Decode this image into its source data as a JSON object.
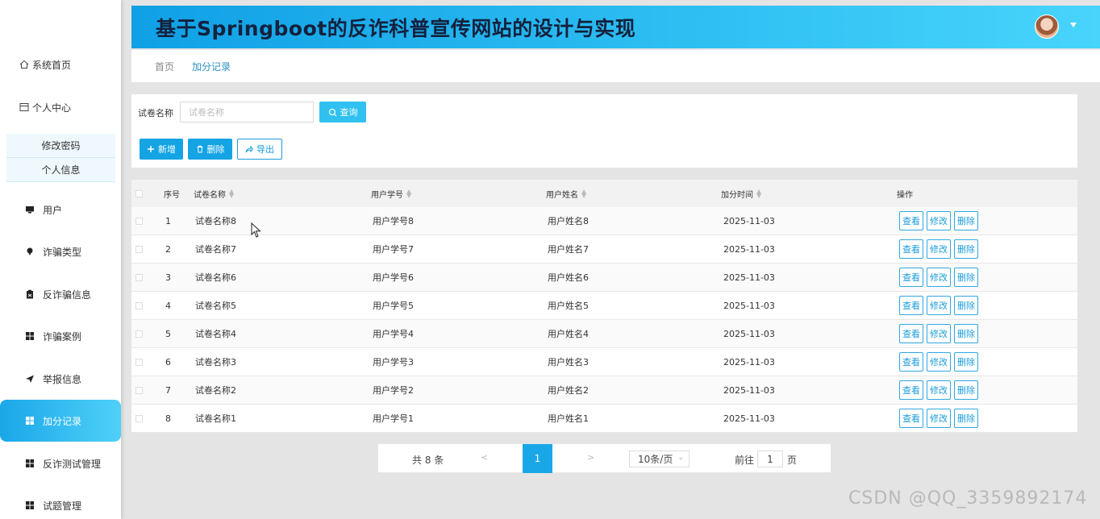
{
  "app": {
    "title": "基于Springboot的反诈科普宣传网站的设计与实现"
  },
  "sidebar": {
    "items": [
      {
        "label": "系统首页",
        "icon": "home-icon"
      },
      {
        "label": "个人中心",
        "icon": "user-card-icon"
      },
      {
        "label": "用户",
        "icon": "monitor-icon"
      },
      {
        "label": "诈骗类型",
        "icon": "pin-icon"
      },
      {
        "label": "反诈骗信息",
        "icon": "clipboard-icon"
      },
      {
        "label": "诈骗案例",
        "icon": "grid-icon"
      },
      {
        "label": "举报信息",
        "icon": "send-icon"
      },
      {
        "label": "加分记录",
        "icon": "grid-icon"
      },
      {
        "label": "反诈测试管理",
        "icon": "grid-icon"
      },
      {
        "label": "试题管理",
        "icon": "grid-icon"
      }
    ],
    "subitems": [
      {
        "label": "修改密码"
      },
      {
        "label": "个人信息"
      }
    ],
    "active": "加分记录"
  },
  "breadcrumb": {
    "home": "首页",
    "current": "加分记录"
  },
  "search": {
    "label": "试卷名称",
    "placeholder": "试卷名称",
    "query_label": "查询"
  },
  "toolbar": {
    "add_label": "新增",
    "delete_label": "删除",
    "export_label": "导出"
  },
  "table": {
    "headers": {
      "index": "序号",
      "paper": "试卷名称",
      "student_no": "用户学号",
      "name": "用户姓名",
      "time": "加分时间",
      "ops": "操作"
    },
    "op_labels": {
      "view": "查看",
      "edit": "修改",
      "delete": "删除"
    },
    "rows": [
      {
        "index": "1",
        "paper": "试卷名称8",
        "student_no": "用户学号8",
        "name": "用户姓名8",
        "time": "2025-11-03"
      },
      {
        "index": "2",
        "paper": "试卷名称7",
        "student_no": "用户学号7",
        "name": "用户姓名7",
        "time": "2025-11-03"
      },
      {
        "index": "3",
        "paper": "试卷名称6",
        "student_no": "用户学号6",
        "name": "用户姓名6",
        "time": "2025-11-03"
      },
      {
        "index": "4",
        "paper": "试卷名称5",
        "student_no": "用户学号5",
        "name": "用户姓名5",
        "time": "2025-11-03"
      },
      {
        "index": "5",
        "paper": "试卷名称4",
        "student_no": "用户学号4",
        "name": "用户姓名4",
        "time": "2025-11-03"
      },
      {
        "index": "6",
        "paper": "试卷名称3",
        "student_no": "用户学号3",
        "name": "用户姓名3",
        "time": "2025-11-03"
      },
      {
        "index": "7",
        "paper": "试卷名称2",
        "student_no": "用户学号2",
        "name": "用户姓名2",
        "time": "2025-11-03"
      },
      {
        "index": "8",
        "paper": "试卷名称1",
        "student_no": "用户学号1",
        "name": "用户姓名1",
        "time": "2025-11-03"
      }
    ]
  },
  "pagination": {
    "total": "共 8 条",
    "prev": "<",
    "current_page": "1",
    "next": ">",
    "page_size": "10条/页",
    "goto_prefix": "前往",
    "goto_value": "1",
    "goto_suffix": "页"
  },
  "watermark": "CSDN @QQ_3359892174",
  "colors": {
    "accent": "#1aa7e8",
    "header_gradient_start": "#10a0e6",
    "header_gradient_end": "#48d4fb"
  }
}
